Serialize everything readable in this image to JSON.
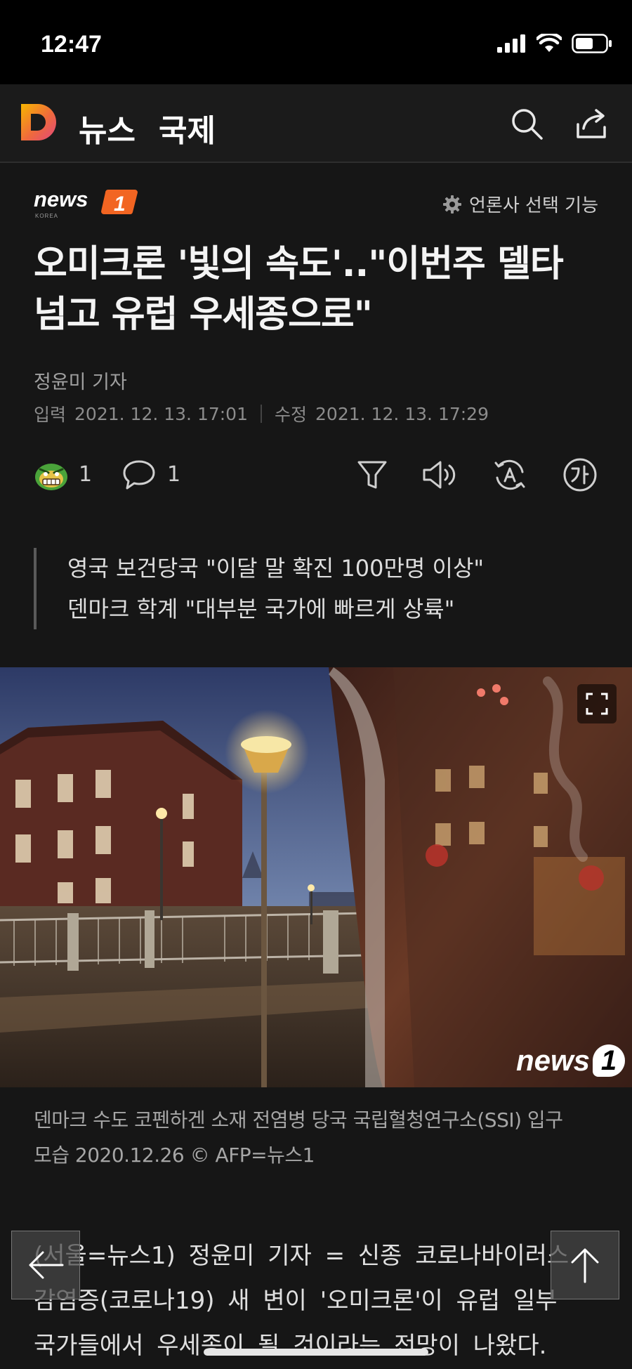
{
  "status_bar": {
    "time": "12:47"
  },
  "nav": {
    "title": "뉴스",
    "section": "국제"
  },
  "press": {
    "logo_text": "news1",
    "logo_sub": "KOREA",
    "select_label": "언론사 선택 기능"
  },
  "article": {
    "headline_line1": "오미크론 '빛의 속도'..\"이번주 델타",
    "headline_line2": "넘고 유럽 우세종으로\"",
    "reporter": "정윤미 기자",
    "input_label": "입력",
    "input_date": "2021. 12. 13. 17:01",
    "edit_label": "수정",
    "edit_date": "2021. 12. 13. 17:29"
  },
  "actions": {
    "reaction_count": "1",
    "comment_count": "1"
  },
  "summary": {
    "line1": "영국 보건당국 \"이달 말 확진 100만명 이상\"",
    "line2": "덴마크 학계 \"대부분 국가에 빠르게 상륙\""
  },
  "photo": {
    "watermark": "news",
    "watermark_one": "1",
    "caption_line1": "덴마크 수도 코펜하겐 소재 전염병 당국 국립혈청연구소(SSI) 입구",
    "caption_line2": "모습 2020.12.26 © AFP=뉴스1"
  },
  "body": {
    "line1": "(서울=뉴스1) 정윤미 기자 = 신종 코로나바이러스",
    "line2": "감염증(코로나19) 새 변이 '오미크론'이 유럽 일부",
    "line3": "국가들에서 우세종이 될 것이라는 전망이 나왔다."
  },
  "colors": {
    "background": "#161616",
    "navbar": "#1b1b1b",
    "news1_orange": "#f26522",
    "logo_yellow": "#f7b500",
    "logo_pink": "#e2487c"
  }
}
